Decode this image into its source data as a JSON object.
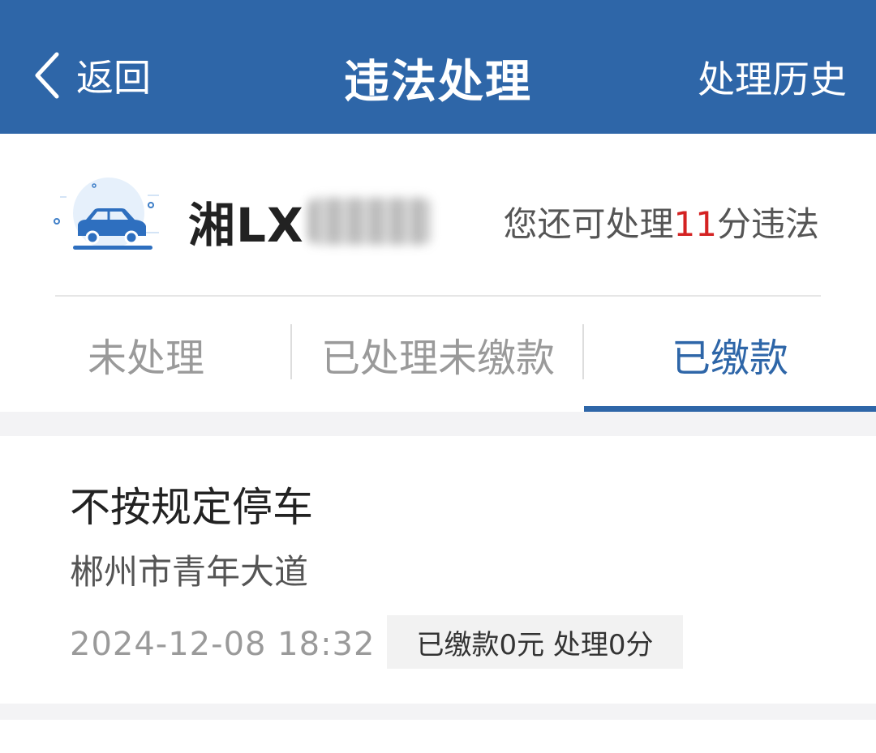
{
  "header": {
    "back_label": "返回",
    "title": "违法处理",
    "history_label": "处理历史",
    "background_color": "#2e66a8"
  },
  "vehicle": {
    "plate_visible": "湘LX",
    "points_prefix": "您还可处理",
    "points_value": "11",
    "points_suffix": "分违法",
    "icon": "car-icon"
  },
  "tabs": [
    {
      "label": "未处理",
      "active": false
    },
    {
      "label": "已处理未缴款",
      "active": false
    },
    {
      "label": "已缴款",
      "active": true
    }
  ],
  "records": [
    {
      "title": "不按规定停车",
      "location": "郴州市青年大道",
      "time": "2024-12-08 18:32",
      "status": "已缴款0元 处理0分"
    }
  ],
  "colors": {
    "accent": "#2e66a8",
    "highlight": "#d42222"
  }
}
